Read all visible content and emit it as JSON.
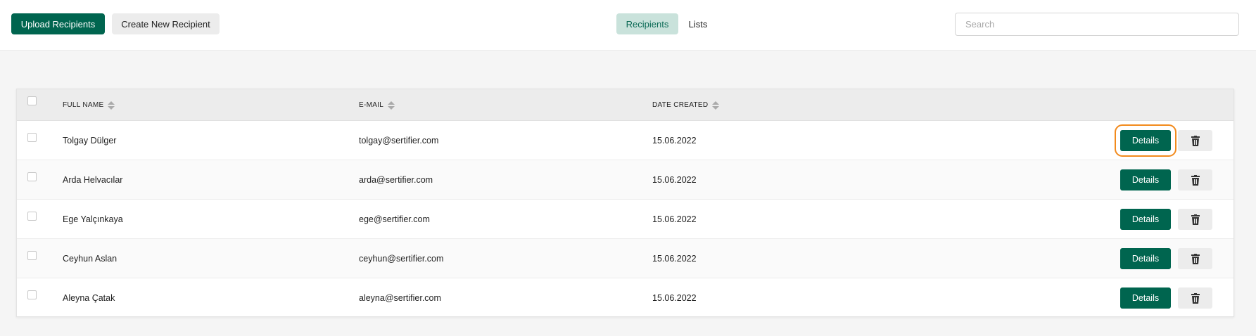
{
  "toolbar": {
    "upload_label": "Upload Recipients",
    "create_label": "Create New Recipient"
  },
  "tabs": {
    "recipients": "Recipients",
    "lists": "Lists",
    "active": "Recipients"
  },
  "search": {
    "placeholder": "Search",
    "value": ""
  },
  "table": {
    "headers": {
      "name": "FULL NAME",
      "email": "E-MAIL",
      "date": "DATE CREATED"
    },
    "rows": [
      {
        "name": "Tolgay Dülger",
        "email": "tolgay@sertifier.com",
        "date": "15.06.2022",
        "details": "Details"
      },
      {
        "name": "Arda Helvacılar",
        "email": "arda@sertifier.com",
        "date": "15.06.2022",
        "details": "Details"
      },
      {
        "name": "Ege Yalçınkaya",
        "email": "ege@sertifier.com",
        "date": "15.06.2022",
        "details": "Details"
      },
      {
        "name": "Ceyhun Aslan",
        "email": "ceyhun@sertifier.com",
        "date": "15.06.2022",
        "details": "Details"
      },
      {
        "name": "Aleyna Çatak",
        "email": "aleyna@sertifier.com",
        "date": "15.06.2022",
        "details": "Details"
      }
    ]
  },
  "colors": {
    "brand": "#00654f",
    "active_tab_bg": "#c9e2db",
    "focus_outline": "#f28a1c"
  },
  "icons": {
    "delete": "trash-icon",
    "sort": "sort-icon"
  }
}
